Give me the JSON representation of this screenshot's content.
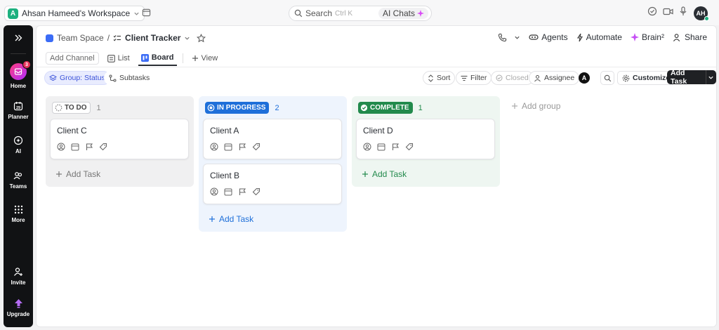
{
  "workspace": {
    "initial": "A",
    "name": "Ahsan Hameed's Workspace"
  },
  "search": {
    "label": "Search",
    "shortcut": "Ctrl K",
    "ai_chats": "AI Chats"
  },
  "user": {
    "initials": "AH"
  },
  "sidebar": {
    "home_badge": "3",
    "items": [
      {
        "label": "Home"
      },
      {
        "label": "Planner",
        "date": "29"
      },
      {
        "label": "AI"
      },
      {
        "label": "Teams"
      },
      {
        "label": "More"
      },
      {
        "label": "Invite"
      },
      {
        "label": "Upgrade"
      }
    ]
  },
  "breadcrumb": {
    "space": "Team Space",
    "separator": "/",
    "list": "Client Tracker"
  },
  "header_actions": {
    "agents": "Agents",
    "automate": "Automate",
    "brain": "Brain²",
    "share": "Share"
  },
  "view_tabs": {
    "add_channel": "Add Channel",
    "list": "List",
    "board": "Board",
    "add_view": "View"
  },
  "toolbar": {
    "group": "Group: Status",
    "subtasks": "Subtasks",
    "sort": "Sort",
    "filter": "Filter",
    "closed": "Closed",
    "assignee": "Assignee",
    "assignee_initial": "A",
    "customize": "Customize",
    "add_task": "Add Task"
  },
  "board": {
    "columns": [
      {
        "status": "TO DO",
        "count": "1",
        "color": "#f0f0f1",
        "cards": [
          "Client C"
        ],
        "add_label": "Add Task"
      },
      {
        "status": "IN PROGRESS",
        "count": "2",
        "color": "#eef4fd",
        "cards": [
          "Client A",
          "Client B"
        ],
        "add_label": "Add Task"
      },
      {
        "status": "COMPLETE",
        "count": "1",
        "color": "#eef6f1",
        "cards": [
          "Client D"
        ],
        "add_label": "Add Task"
      }
    ],
    "add_group": "Add group"
  },
  "colors": {
    "accent": "#3b6cf6",
    "in_progress": "#1e6fd9",
    "complete": "#228a4c"
  }
}
